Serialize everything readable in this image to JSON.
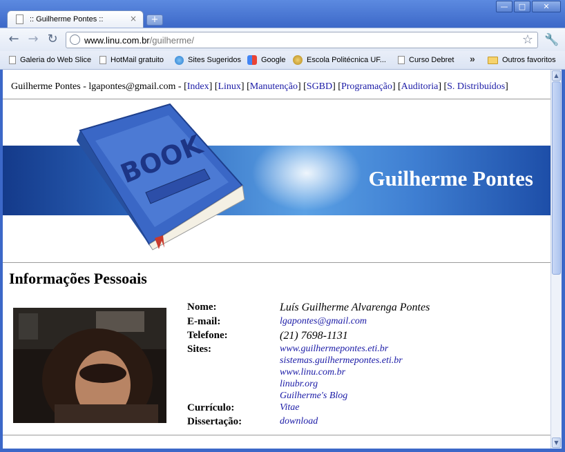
{
  "browser": {
    "tab_title": ":: Guilherme Pontes ::",
    "tab_close": "×",
    "new_tab": "+",
    "url_host": "www.linu.com.br",
    "url_path": "/guilherme/",
    "window_buttons": {
      "minimize": "—",
      "maximize": "□",
      "close": "✕"
    },
    "nav": {
      "back": "←",
      "forward": "→",
      "reload": "↻"
    },
    "bookmarks": [
      {
        "label": "Galeria do Web Slice",
        "icon": "page-icon"
      },
      {
        "label": "HotMail gratuito",
        "icon": "page-icon"
      },
      {
        "label": "Sites Sugeridos",
        "icon": "ie-icon"
      },
      {
        "label": "Google",
        "icon": "google-icon"
      },
      {
        "label": "Escola Politécnica UF...",
        "icon": "seal-icon"
      },
      {
        "label": "Curso Debret",
        "icon": "page-icon"
      }
    ],
    "bookmarks_overflow": "»",
    "other_bookmarks": "Outros favoritos"
  },
  "page": {
    "top_nav_prefix": "Guilherme Pontes - lgapontes@gmail.com - ",
    "nav_links": [
      "Index",
      "Linux",
      "Manutenção",
      "SGBD",
      "Programação",
      "Auditoria",
      "S. Distribuídos"
    ],
    "banner_book_text": "BOOK",
    "banner_title": "Guilherme Pontes",
    "section_title": "Informações Pessoais",
    "info": {
      "nome_label": "Nome:",
      "nome": "Luís Guilherme Alvarenga Pontes",
      "email_label": "E-mail:",
      "email": "lgapontes@gmail.com",
      "telefone_label": "Telefone:",
      "telefone": "(21) 7698-1131",
      "sites_label": "Sites:",
      "sites": [
        "www.guilhermepontes.eti.br",
        "sistemas.guilhermepontes.eti.br",
        "www.linu.com.br",
        "linubr.org",
        "Guilherme's Blog"
      ],
      "curriculo_label": "Currículo:",
      "curriculo": "Vitae",
      "dissertacao_label": "Dissertação:",
      "dissertacao": "download"
    }
  }
}
